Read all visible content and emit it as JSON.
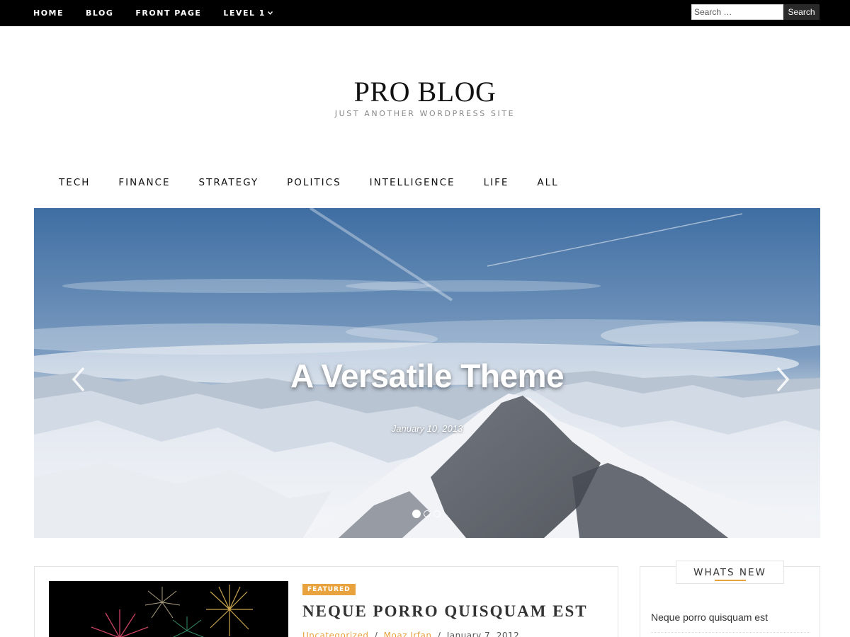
{
  "topnav": {
    "items": [
      "HOME",
      "BLOG",
      "FRONT PAGE",
      "LEVEL 1"
    ],
    "search_placeholder": "Search …",
    "search_button": "Search"
  },
  "branding": {
    "title": "PRO BLOG",
    "description": "JUST ANOTHER WORDPRESS SITE"
  },
  "categories": [
    "TECH",
    "FINANCE",
    "STRATEGY",
    "POLITICS",
    "INTELLIGENCE",
    "LIFE",
    "ALL"
  ],
  "slider": {
    "title": "A Versatile Theme",
    "date": "January 10, 2013",
    "slide_count": 3,
    "active_slide": 1
  },
  "featured_post": {
    "badge": "FEATURED",
    "title": "NEQUE PORRO QUISQUAM EST",
    "category": "Uncategorized",
    "author": "Moaz Irfan",
    "date": "January 7, 2012",
    "separator": "/"
  },
  "sidebar": {
    "widget_title": "WHATS NEW",
    "items": [
      "Neque porro quisquam est"
    ]
  },
  "colors": {
    "accent": "#e8a23e",
    "topbar": "#000000"
  }
}
